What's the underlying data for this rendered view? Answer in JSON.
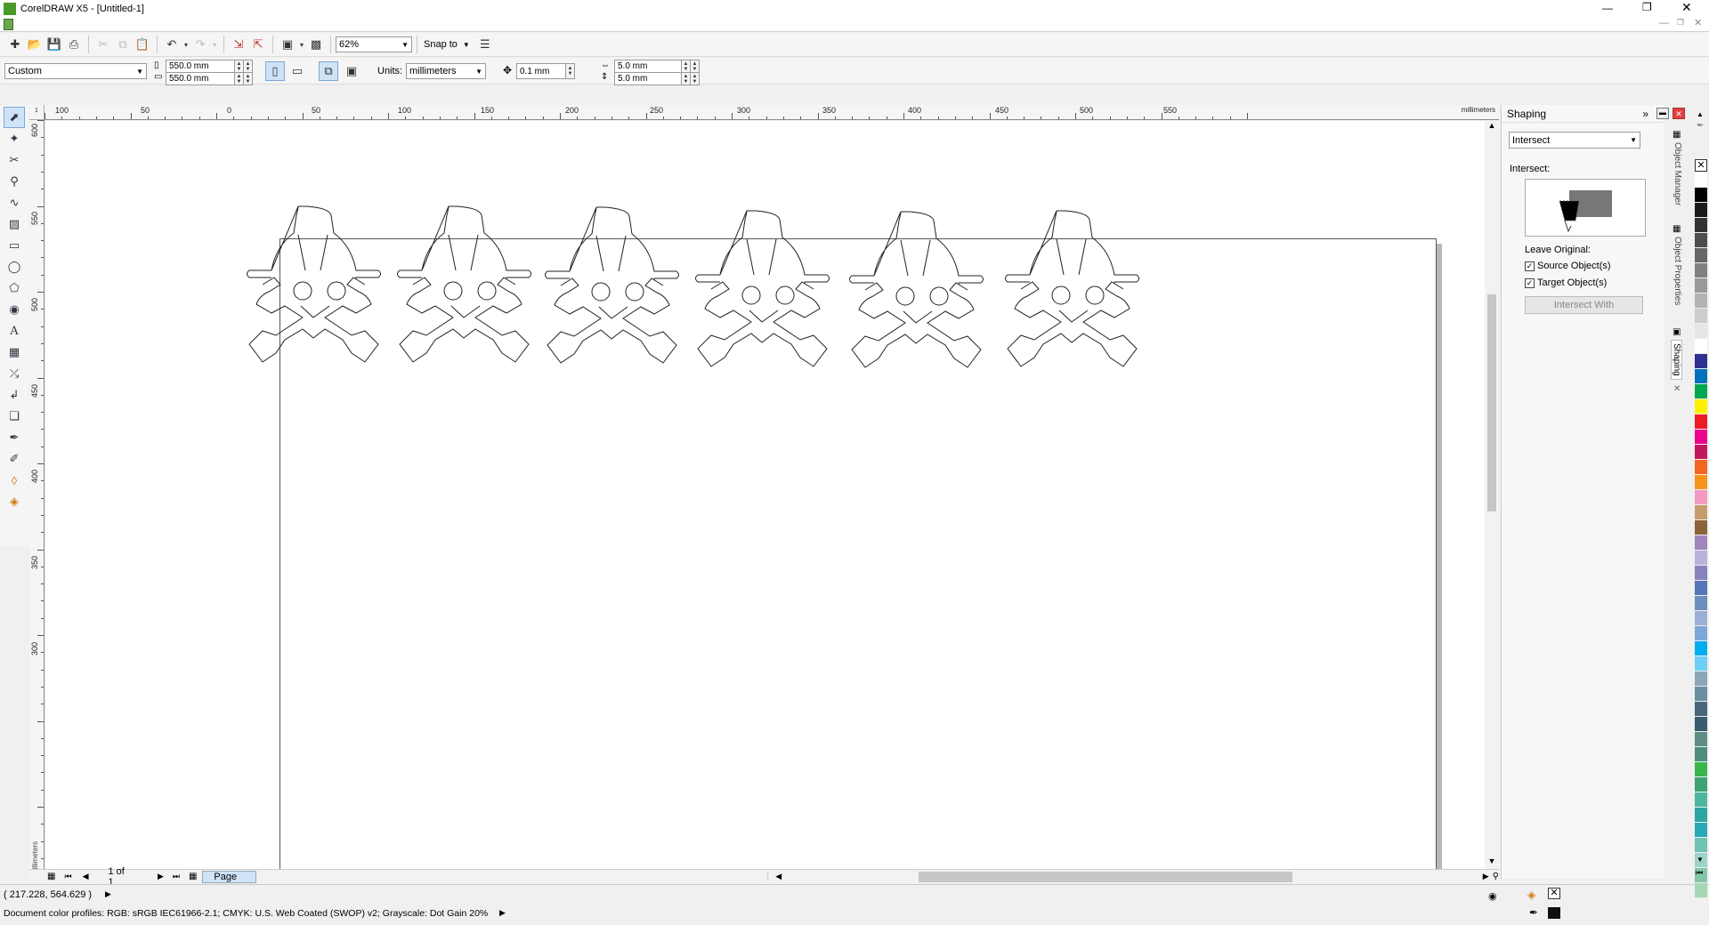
{
  "window": {
    "title": "CorelDRAW X5 - [Untitled-1]"
  },
  "standard_toolbar": {
    "zoom_value": "62%",
    "snap_label": "Snap to"
  },
  "property_bar": {
    "page_preset": "Custom",
    "page_width": "550.0 mm",
    "page_height": "550.0 mm",
    "units_label": "Units:",
    "units_value": "millimeters",
    "nudge": "0.1 mm",
    "dup_x": "5.0 mm",
    "dup_y": "5.0 mm"
  },
  "rulers": {
    "unit": "millimeters",
    "h_ticks": [
      "100",
      "50",
      "0",
      "50",
      "100",
      "150",
      "200",
      "250",
      "300",
      "350",
      "400",
      "450",
      "500",
      "550"
    ],
    "v_ticks": [
      "600",
      "550",
      "500",
      "450",
      "400",
      "350",
      "300"
    ],
    "v_unit": "millimeters"
  },
  "page_nav": {
    "counter": "1 of 1",
    "tab": "Page 1"
  },
  "status": {
    "coords": "( 217.228, 564.629 )",
    "profiles": "Document color profiles: RGB: sRGB IEC61966-2.1; CMYK: U.S. Web Coated (SWOP) v2; Grayscale: Dot Gain 20%"
  },
  "shaping_docker": {
    "title": "Shaping",
    "mode": "Intersect",
    "section_label": "Intersect:",
    "leave_original": "Leave Original:",
    "source_label": "Source Object(s)",
    "target_label": "Target Object(s)",
    "source_checked": true,
    "target_checked": true,
    "apply_button": "Intersect With"
  },
  "docker_tabs": [
    "Object Manager",
    "Object Properties",
    "Shaping"
  ],
  "palette": [
    "#ffffff",
    "#000000",
    "#1a1a1a",
    "#333333",
    "#4d4d4d",
    "#666666",
    "#808080",
    "#999999",
    "#b3b3b3",
    "#cccccc",
    "#e6e6e6",
    "#ffffff",
    "#2e3192",
    "#0072bc",
    "#00a651",
    "#fff200",
    "#ed1c24",
    "#ec008c",
    "#c2185b",
    "#f26522",
    "#f7941d",
    "#f49ac1",
    "#c69c6d",
    "#8c6239",
    "#a186be",
    "#bcb3db",
    "#8781bd",
    "#5674b9",
    "#6c8ebf",
    "#9ab0d6",
    "#7da7d9",
    "#00aeef",
    "#6dcff6",
    "#8ba6b7",
    "#6b8fa3",
    "#49667d",
    "#3a5a6e",
    "#5e8c84",
    "#4e8d7c",
    "#39b54a",
    "#3ca372",
    "#4cb69f",
    "#2ba6a0",
    "#29a9b5",
    "#6fc2b4",
    "#9dd3c8",
    "#84c5a7",
    "#a7d7b5"
  ],
  "canvas": {
    "object_count": 6
  }
}
